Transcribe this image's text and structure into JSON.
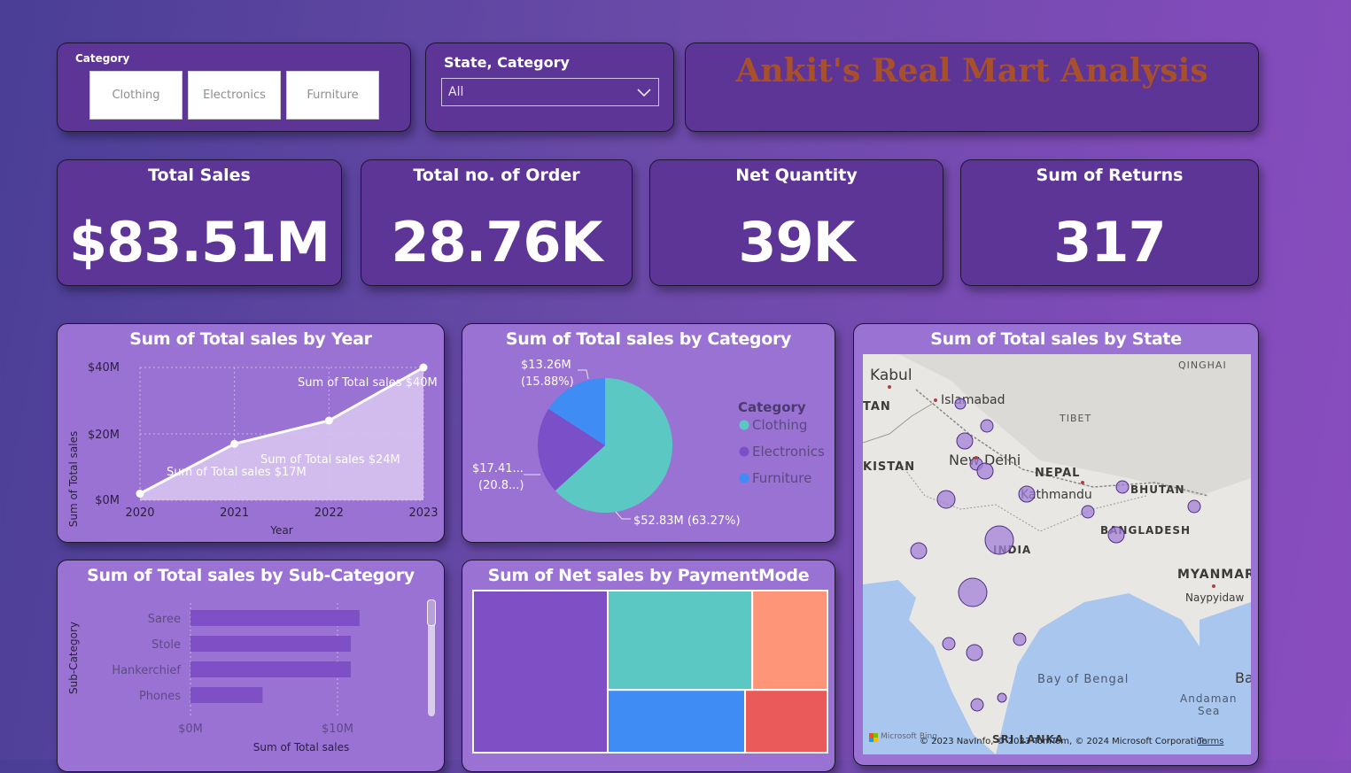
{
  "slicer_category": {
    "label": "Category",
    "buttons": [
      "Clothing",
      "Electronics",
      "Furniture"
    ]
  },
  "slicer_state": {
    "label": "State, Category",
    "selected": "All"
  },
  "banner": {
    "title": "Ankit's Real Mart Analysis"
  },
  "kpis": [
    {
      "label": "Total Sales",
      "value": "$83.51M"
    },
    {
      "label": "Total no. of Order",
      "value": "28.76K"
    },
    {
      "label": "Net Quantity",
      "value": "39K"
    },
    {
      "label": "Sum of Returns",
      "value": "317"
    }
  ],
  "year_chart": {
    "title": "Sum of Total sales by Year",
    "ylabel": "Sum of Total sales",
    "xlabel": "Year",
    "yticks": [
      "$40M",
      "$20M",
      "$0M"
    ],
    "labels": [
      "Sum of Total sales $40M",
      "Sum of Total sales $24M",
      "Sum of Total sales $17M"
    ]
  },
  "category_chart": {
    "title": "Sum of Total sales by Category",
    "legend_title": "Category",
    "labels": [
      "$13.26M",
      "(15.88%)",
      "$17.41...",
      "(20.8...)",
      "$52.83M (63.27%)"
    ]
  },
  "subcat_chart": {
    "title": "Sum of Total sales by Sub-Category",
    "ylabel": "Sub-Category",
    "xlabel": "Sum of Total sales",
    "xticks": [
      "$0M",
      "$10M"
    ]
  },
  "payment_chart": {
    "title": "Sum of Net sales by PaymentMode"
  },
  "map": {
    "title": "Sum of Total sales by State",
    "labels": {
      "kabul": "Kabul",
      "islamabad": "Islamabad",
      "tan": "TAN",
      "kistan": "KISTAN",
      "newdelhi": "New Delhi",
      "nepal": "NEPAL",
      "kathmandu": "Kathmandu",
      "tibet": "TIBET",
      "qinghai": "QINGHAI",
      "bhutan": "BHUTAN",
      "bangladesh": "BANGLADESH",
      "india": "INDIA",
      "myanmar": "MYANMAR",
      "naypyidaw": "Naypyidaw",
      "bay": "Bay of Bengal",
      "andaman": "Andaman",
      "sea": "Sea",
      "srilanka": "SRI LANKA",
      "ba": "Ba"
    },
    "footer_brand": "Microsoft Bing",
    "copyright": "© 2023 NavInfo, © 2023 TomTom, © 2024 Microsoft Corporation",
    "terms": "Terms"
  },
  "chart_data": [
    {
      "type": "area",
      "title": "Sum of Total sales by Year",
      "xlabel": "Year",
      "ylabel": "Sum of Total sales",
      "categories": [
        "2020",
        "2021",
        "2022",
        "2023"
      ],
      "values": [
        2,
        17,
        24,
        40
      ],
      "unit": "$M",
      "ylim": [
        0,
        40
      ],
      "yticks": [
        0,
        20,
        40
      ],
      "grid": true
    },
    {
      "type": "pie",
      "title": "Sum of Total sales by Category",
      "legend_position": "right",
      "slices": [
        {
          "name": "Clothing",
          "value": 52.83,
          "percent": 63.27,
          "color": "#5cc8c4"
        },
        {
          "name": "Electronics",
          "value": 17.41,
          "percent": 20.8,
          "color": "#7b4fc8"
        },
        {
          "name": "Furniture",
          "value": 13.26,
          "percent": 15.88,
          "color": "#3f8cf5"
        }
      ]
    },
    {
      "type": "bar",
      "orientation": "horizontal",
      "title": "Sum of Total sales by Sub-Category",
      "xlabel": "Sum of Total sales",
      "ylabel": "Sub-Category",
      "categories": [
        "Saree",
        "Stole",
        "Hankerchief",
        "Phones"
      ],
      "values": [
        11.5,
        10.9,
        10.9,
        4.9
      ],
      "unit": "$M",
      "xticks": [
        0,
        10
      ],
      "grid": true
    },
    {
      "type": "treemap",
      "title": "Sum of Net sales by PaymentMode",
      "colors": [
        "#7f4fc5",
        "#5cc8c4",
        "#fe9478",
        "#3f8cf5",
        "#eb5a5a"
      ],
      "relative_areas": [
        0.38,
        0.25,
        0.13,
        0.15,
        0.09
      ]
    }
  ]
}
